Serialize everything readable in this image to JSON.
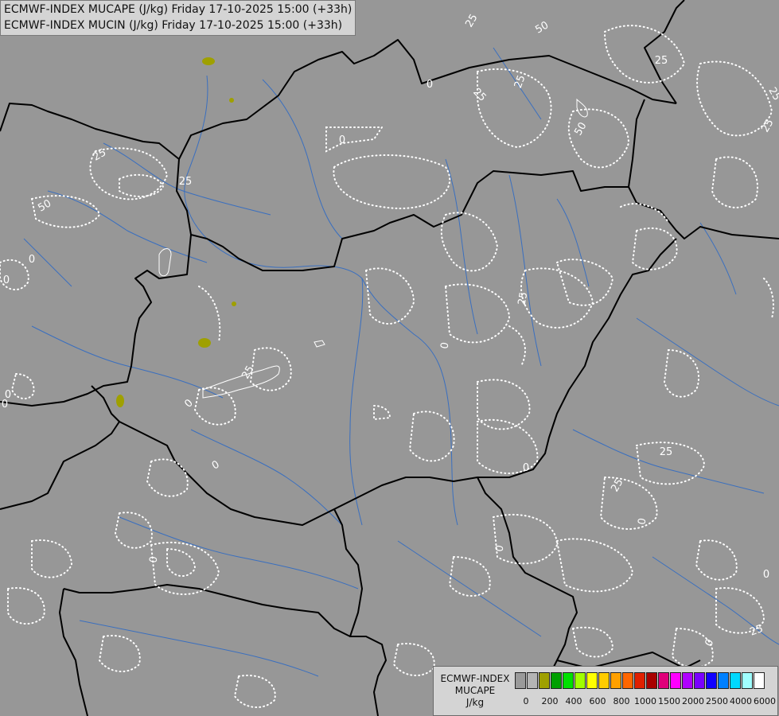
{
  "header": {
    "line1": "ECMWF-INDEX MUCAPE (J/kg) Friday 17-10-2025 15:00 (+33h)",
    "line2": "ECMWF-INDEX MUCIN (J/kg) Friday 17-10-2025 15:00 (+33h)"
  },
  "legend": {
    "title_line1": "ECMWF-INDEX",
    "title_line2": "MUCAPE",
    "title_line3": "J/kg",
    "colors": [
      "#9a9a9a",
      "#b4b4b4",
      "#9fa000",
      "#00a000",
      "#00e000",
      "#a0ff00",
      "#ffff00",
      "#ffcc00",
      "#ffa000",
      "#ff6600",
      "#e02000",
      "#a80000",
      "#e0007a",
      "#ff00ff",
      "#b000ff",
      "#7a00ff",
      "#1000ff",
      "#0080ff",
      "#00d8ff",
      "#a0ffff",
      "#ffffff"
    ],
    "tick_labels": [
      "0",
      "200",
      "400",
      "600",
      "800",
      "1000",
      "1500",
      "2000",
      "2500",
      "4000",
      "6000"
    ]
  },
  "contour_labels": [
    "25",
    "50",
    "25",
    "25",
    "25",
    "0",
    "25",
    "25",
    "50",
    "0",
    "50",
    "25",
    "0",
    "25",
    "0",
    "0",
    "0",
    "25",
    "25",
    "0",
    "0",
    "0",
    "0",
    "0",
    "25",
    "0",
    "25",
    "0",
    "25",
    "0",
    "0"
  ],
  "colors": {
    "background": "#979797",
    "border": "#000000",
    "river": "#3a6fbf",
    "contour": "#ffffff"
  }
}
